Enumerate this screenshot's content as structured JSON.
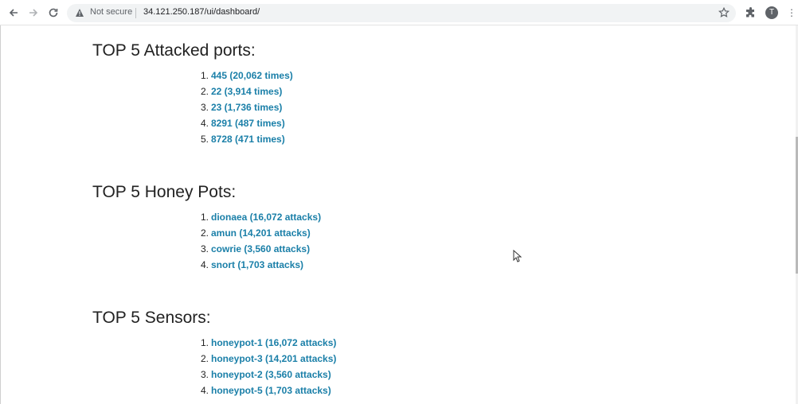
{
  "browser": {
    "security_label": "Not secure",
    "url": "34.121.250.187/ui/dashboard/",
    "profile_initial": "T"
  },
  "sections": [
    {
      "title": "TOP 5 Attacked ports:",
      "items": [
        {
          "num": "1.",
          "label": "445 (20,062 times)"
        },
        {
          "num": "2.",
          "label": "22 (3,914 times)"
        },
        {
          "num": "3.",
          "label": "23 (1,736 times)"
        },
        {
          "num": "4.",
          "label": "8291 (487 times)"
        },
        {
          "num": "5.",
          "label": "8728 (471 times)"
        }
      ]
    },
    {
      "title": "TOP 5 Honey Pots:",
      "items": [
        {
          "num": "1.",
          "label": "dionaea (16,072 attacks)"
        },
        {
          "num": "2.",
          "label": "amun (14,201 attacks)"
        },
        {
          "num": "3.",
          "label": "cowrie (3,560 attacks)"
        },
        {
          "num": "4.",
          "label": "snort (1,703 attacks)"
        }
      ]
    },
    {
      "title": "TOP 5 Sensors:",
      "items": [
        {
          "num": "1.",
          "label": "honeypot-1 (16,072 attacks)"
        },
        {
          "num": "2.",
          "label": "honeypot-3 (14,201 attacks)"
        },
        {
          "num": "3.",
          "label": "honeypot-2 (3,560 attacks)"
        },
        {
          "num": "4.",
          "label": "honeypot-5 (1,703 attacks)"
        }
      ]
    }
  ],
  "colors": {
    "link": "#1a7fa8",
    "heading": "#222222"
  }
}
